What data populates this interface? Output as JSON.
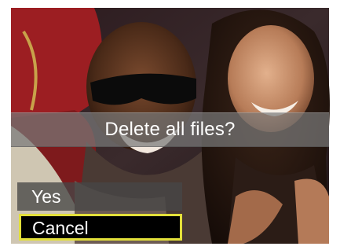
{
  "dialog": {
    "prompt": "Delete all files?",
    "options": [
      {
        "label": "Yes",
        "selected": false
      },
      {
        "label": "Cancel",
        "selected": true
      }
    ]
  },
  "colors": {
    "highlight_border": "#e3e03a",
    "prompt_bar": "#787878",
    "selected_option_bg": "#000000",
    "unselected_option_bg": "#464646",
    "text": "#ffffff"
  },
  "icons": []
}
